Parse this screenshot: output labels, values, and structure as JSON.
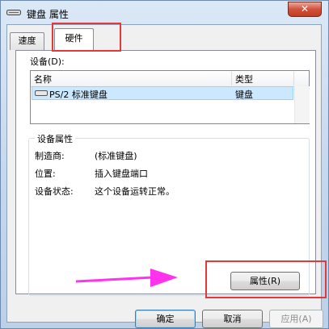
{
  "window": {
    "title": "键盘 属性",
    "close_label": "✕"
  },
  "tabs": [
    {
      "label": "速度",
      "active": false
    },
    {
      "label": "硬件",
      "active": true
    }
  ],
  "devices": {
    "label": "设备(D):",
    "columns": [
      "名称",
      "类型"
    ],
    "rows": [
      {
        "name": "PS/2 标准键盘",
        "type": "键盘"
      }
    ]
  },
  "device_properties": {
    "group_title": "设备属性",
    "fields": [
      {
        "label": "制造商:",
        "value": "(标准键盘)"
      },
      {
        "label": "位置:",
        "value": "插入键盘端口"
      },
      {
        "label": "设备状态:",
        "value": "这个设备运转正常。"
      }
    ],
    "properties_button": "属性(R)"
  },
  "buttons": {
    "ok": "确定",
    "cancel": "取消",
    "apply": "应用(A)"
  },
  "annotations": {
    "highlight_color": "#e03a3a",
    "arrow_color": "#ff33ee"
  }
}
